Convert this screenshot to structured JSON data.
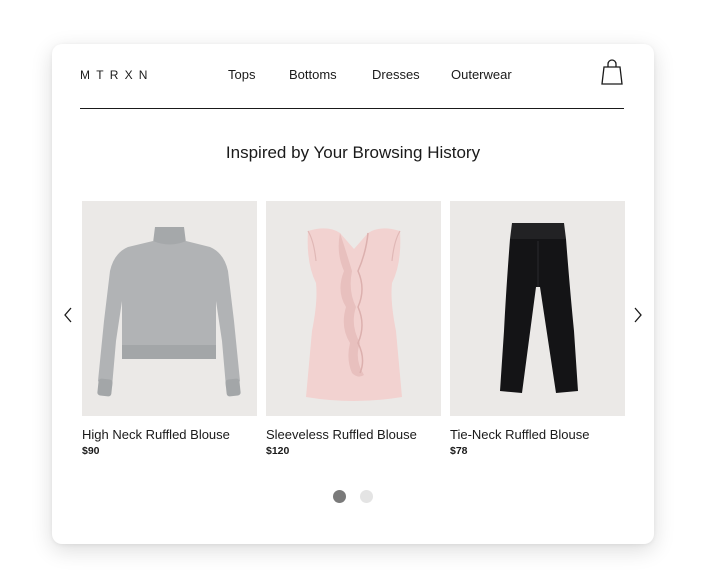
{
  "brand": {
    "logo_text": "MTRXN"
  },
  "nav": {
    "items": [
      {
        "label": "Tops"
      },
      {
        "label": "Bottoms"
      },
      {
        "label": "Dresses"
      },
      {
        "label": "Outerwear"
      }
    ]
  },
  "cart": {
    "icon": "shopping-bag-icon"
  },
  "section": {
    "title": "Inspired by Your Browsing History"
  },
  "carousel": {
    "prev_icon": "chevron-left-icon",
    "next_icon": "chevron-right-icon",
    "products": [
      {
        "name": "High Neck Ruffled Blouse",
        "price": "$90",
        "image": "gray-sweater"
      },
      {
        "name": "Sleeveless Ruffled Blouse",
        "price": "$120",
        "image": "pink-ruffle-top"
      },
      {
        "name": "Tie-Neck Ruffled Blouse",
        "price": "$78",
        "image": "black-trousers"
      }
    ],
    "pagination": {
      "pages": 2,
      "active": 1
    }
  },
  "colors": {
    "text": "#1a1a1a",
    "dot_active": "#7a7a7a",
    "dot_inactive": "#e4e4e4",
    "image_bg": "#ebe9e7"
  }
}
